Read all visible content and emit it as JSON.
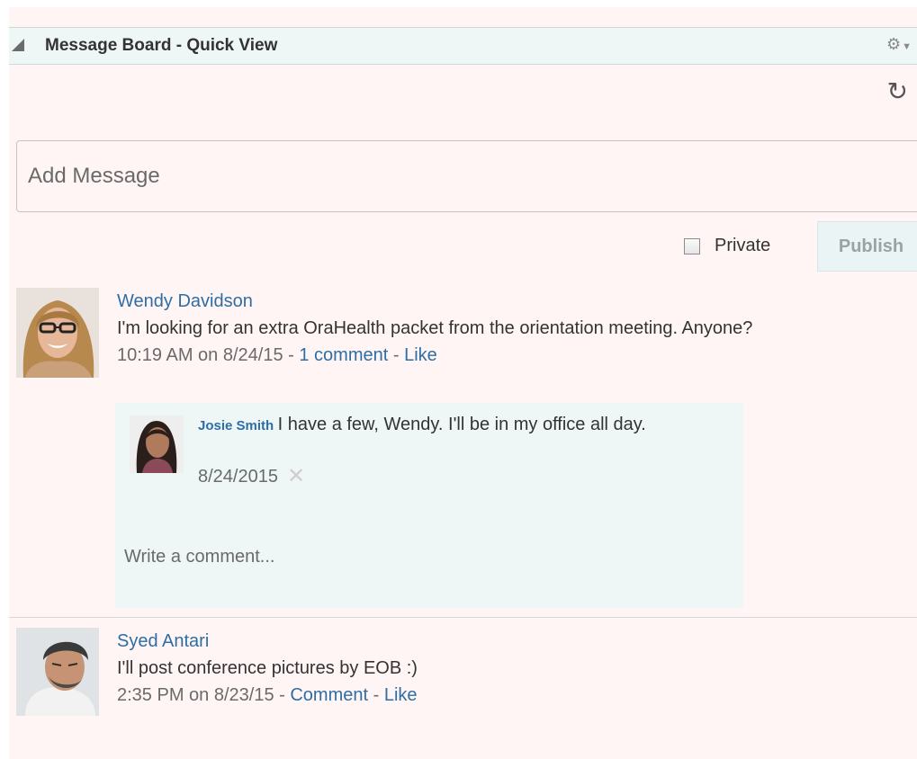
{
  "header": {
    "title": "Message Board - Quick View",
    "collapse_icon": "collapse-triangle-icon",
    "settings_icon": "gear-icon"
  },
  "toolbar": {
    "refresh_icon": "refresh-icon"
  },
  "composer": {
    "placeholder": "Add Message",
    "private_label": "Private",
    "private_checked": false,
    "publish_label": "Publish"
  },
  "posts": [
    {
      "author": "Wendy Davidson",
      "text": "I'm looking for an extra OraHealth packet from the orientation meeting. Anyone?",
      "time": "10:19 AM on 8/24/15",
      "sep1": " - ",
      "comments_link": "1 comment",
      "sep2": " - ",
      "like_link": "Like",
      "comments": [
        {
          "author": "Josie Smith",
          "text": "I have a few, Wendy. I'll be in my office all day.",
          "date": "8/24/2015",
          "delete_icon": "close-icon"
        }
      ],
      "write_comment_placeholder": "Write a comment..."
    },
    {
      "author": "Syed Antari",
      "text": "I'll post conference pictures by EOB :)",
      "time": "2:35 PM on 8/23/15",
      "sep1": " - ",
      "comments_link": "Comment",
      "sep2": " - ",
      "like_link": "Like"
    }
  ],
  "colors": {
    "link": "#2e6ea5",
    "panel_bg": "#fff5f5",
    "header_bg": "#eef6f6"
  }
}
